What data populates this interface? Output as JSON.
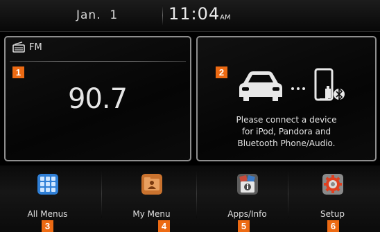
{
  "status": {
    "date": "Jan.  1",
    "time": "11:04",
    "ampm": "AM"
  },
  "radio": {
    "band": "FM",
    "frequency": "90.7",
    "badge": "1",
    "icon": "radio-icon"
  },
  "device": {
    "badge": "2",
    "message": [
      "Please connect a device",
      "for iPod, Pandora and",
      "Bluetooth Phone/Audio."
    ],
    "icons": [
      "car-icon",
      "ellipsis-icon",
      "phone-icon",
      "usb-icon",
      "bluetooth-icon"
    ]
  },
  "menu": [
    {
      "label": "All Menus",
      "badge": "3",
      "icon": "grid-icon"
    },
    {
      "label": "My Menu",
      "badge": "4",
      "icon": "user-card-icon"
    },
    {
      "label": "Apps/Info",
      "badge": "5",
      "icon": "info-icon"
    },
    {
      "label": "Setup",
      "badge": "6",
      "icon": "gear-icon"
    }
  ],
  "colors": {
    "badge": "#ec6a13",
    "panel_border": "#8e8e8e",
    "all_menus_icon": "#2f7fd6",
    "my_menu_icon": "#c9722e",
    "setup_icon_ring": "#e04020"
  }
}
